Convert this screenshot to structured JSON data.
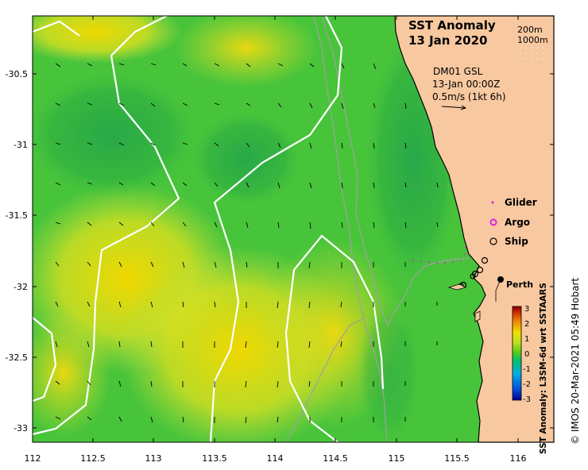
{
  "title": "SST Anomaly",
  "date": "13 Jan 2020",
  "depth_contours": [
    "200m",
    "1000m"
  ],
  "current_info": {
    "line1": "DM01 GSL",
    "line2": "13-Jan 00:00Z",
    "line3": "0.5m/s (1kt 6h)"
  },
  "legend": [
    {
      "label": "Glider",
      "symbol": "dot",
      "color": "#e020e0"
    },
    {
      "label": "Argo",
      "symbol": "circle",
      "color": "#e020e0"
    },
    {
      "label": "Ship",
      "symbol": "circle",
      "color": "#000000"
    }
  ],
  "place_label": "Perth",
  "colorbar": {
    "title": "SST Anomaly: L3SM-6d wrt SSTAARS",
    "ticks": [
      "3",
      "2",
      "1",
      "0",
      "-1",
      "-2",
      "-3"
    ],
    "colors": [
      "#00008b",
      "#0050e0",
      "#00b0e0",
      "#00c070",
      "#60d010",
      "#c0e020",
      "#f0e000",
      "#f08000",
      "#c02000",
      "#800000"
    ]
  },
  "credit": "© IMOS 20-Mar-2021 05:49 Hobart",
  "x_axis": {
    "ticks": [
      "112",
      "112.5",
      "113",
      "113.5",
      "114",
      "114.5",
      "115",
      "115.5",
      "116"
    ]
  },
  "y_axis": {
    "ticks": [
      "-30.5",
      "-31",
      "-31.5",
      "-32",
      "-32.5",
      "-33"
    ]
  },
  "colors": {
    "land": "#f8c8a0",
    "ocean_mid": "#3cc43c",
    "ocean_warm": "#e8e000",
    "contour": "#ffffff",
    "bathy": "#a0a0a0"
  }
}
